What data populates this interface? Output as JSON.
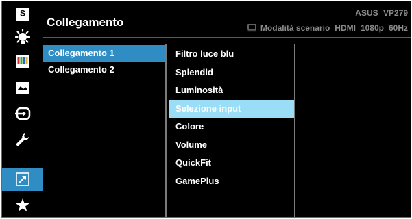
{
  "header": {
    "title": "Collegamento",
    "model": "ASUS  VP279",
    "status": {
      "mode": "Modalità scenario",
      "input": "HDMI",
      "resolution": "1080p",
      "refresh": "60Hz"
    }
  },
  "sidebar": {
    "items": [
      {
        "icon": "splendid-s-icon"
      },
      {
        "icon": "blue-light-filter-icon"
      },
      {
        "icon": "color-bars-icon"
      },
      {
        "icon": "image-icon"
      },
      {
        "icon": "input-select-icon"
      },
      {
        "icon": "wrench-settings-icon"
      },
      {
        "icon": "shortcut-arrow-icon",
        "active": true
      },
      {
        "icon": "star-favorite-icon"
      }
    ]
  },
  "shortcuts": {
    "items": [
      {
        "label": "Collegamento 1",
        "selected": true
      },
      {
        "label": "Collegamento 2",
        "selected": false
      }
    ]
  },
  "functions": {
    "items": [
      {
        "label": "Filtro luce blu"
      },
      {
        "label": "Splendid"
      },
      {
        "label": "Luminosità"
      },
      {
        "label": "Selezione input",
        "highlighted": true
      },
      {
        "label": "Colore"
      },
      {
        "label": "Volume"
      },
      {
        "label": "QuickFit"
      },
      {
        "label": "GamePlus"
      }
    ]
  },
  "colors": {
    "background": "#000000",
    "accent": "#2f8dc4",
    "highlight": "#99ddf6",
    "text": "#ffffff",
    "dim_text": "#8a8a8a"
  }
}
